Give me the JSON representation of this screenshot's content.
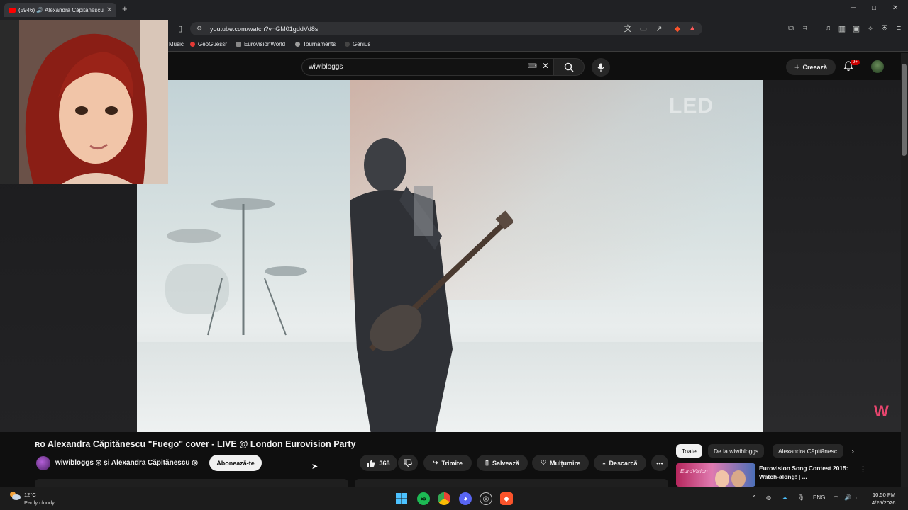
{
  "browser": {
    "tab_title": "(5946) 🔊 Alexandra Căpitănescu",
    "address": "youtube.com/watch?v=GM01gddVd8s",
    "bookmarks": [
      "Music",
      "GeoGuessr",
      "EurovisionWorld",
      "Tournaments",
      "Genius"
    ],
    "window_controls": [
      "─",
      "□",
      "✕"
    ]
  },
  "youtube": {
    "search_value": "wiwibloggs",
    "create_label": "Creează",
    "notification_count": "9+",
    "video_watermark": "LED",
    "corner_logo": "W",
    "video_title": "ʀᴏ Alexandra Căpitănescu \"Fuego\" cover - LIVE @ London Eurovision Party",
    "channel_name": "wiwibloggs ◎ și Alexandra Căpitănescu ◎",
    "subscribe_label": "Abonează-te",
    "likes": "368",
    "share_label": "Trimite",
    "save_label": "Salvează",
    "thanks_label": "Mulțumire",
    "download_label": "Descarcă",
    "more_label": "•••",
    "chips": [
      "Toate",
      "De la wiwibloggs",
      "Alexandra Căpitănesc"
    ],
    "recommendation_title": "Eurovision Song Contest 2015: Watch-along! | ..."
  },
  "taskbar": {
    "temperature": "12°C",
    "weather": "Partly cloudy",
    "language": "ENG",
    "time": "10:50 PM",
    "date": "4/25/2026"
  },
  "colors": {
    "youtube_red": "#ff0000",
    "background": "#0f0f0f",
    "accent_pink": "#e8456e"
  }
}
